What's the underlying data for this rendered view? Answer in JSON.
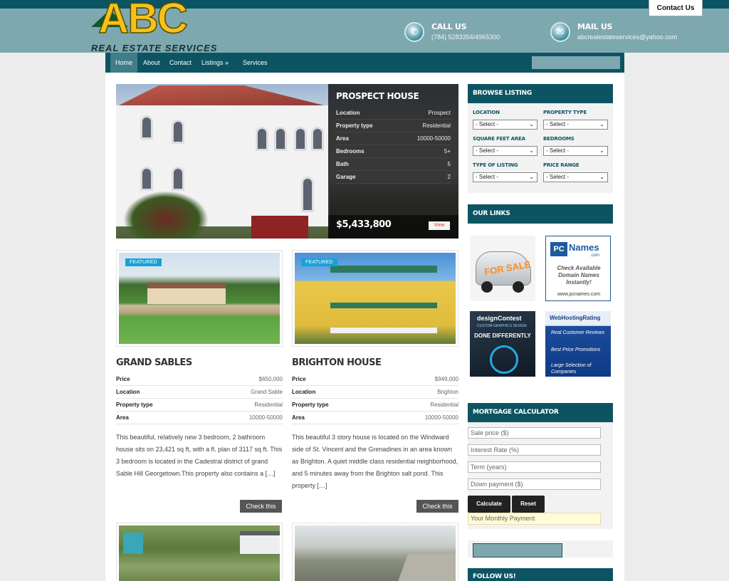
{
  "header": {
    "contact_tab": "Contact Us",
    "logo_letters": "ABC",
    "logo_tagline": "REAL ESTATE SERVICES",
    "call_label": "CALL US",
    "call_value": "(784) 5283354/4965300",
    "mail_label": "MAIL US",
    "mail_value": "abcrealestateservices@yahoo.com"
  },
  "nav": {
    "items": [
      "Home",
      "About",
      "Contact",
      "Listings »",
      "Services"
    ],
    "active": "Home"
  },
  "hero": {
    "title": "PROSPECT HOUSE",
    "rows": [
      {
        "k": "Location",
        "v": "Prospect"
      },
      {
        "k": "Property type",
        "v": "Residential"
      },
      {
        "k": "Area",
        "v": "10000-50000"
      },
      {
        "k": "Bedrooms",
        "v": "5+"
      },
      {
        "k": "Bath",
        "v": "5"
      },
      {
        "k": "Garage",
        "v": "2"
      }
    ],
    "price": "$5,433,800",
    "view_label": "View"
  },
  "listings": [
    {
      "badge": "FEATURED",
      "title": "GRAND SABLES",
      "rows": [
        {
          "k": "Price",
          "v": "$650,000"
        },
        {
          "k": "Location",
          "v": "Grand Sable"
        },
        {
          "k": "Property type",
          "v": "Residential"
        },
        {
          "k": "Area",
          "v": "10000-50000"
        }
      ],
      "desc": "This beautiful, relatively new 3 bedroom, 2 bathroom house sits on 23,421 sq ft, with a fl. plan of 3117 sq ft. This 3 bedroom is located in the Cadestral district of grand Sable Hill Georgetown.This property also contains a […]",
      "button": "Check this"
    },
    {
      "badge": "FEATURED",
      "title": "BRIGHTON HOUSE",
      "rows": [
        {
          "k": "Price",
          "v": "$949,000"
        },
        {
          "k": "Location",
          "v": "Brighton"
        },
        {
          "k": "Property type",
          "v": "Residential"
        },
        {
          "k": "Area",
          "v": "10000-50000"
        }
      ],
      "desc": "This beautiful 3 story house is located on the Windward side of St. Vincent and the Grenadines in an area known as Brighton. A quiet middle class residential neighborhood, and 5 minutes away from the Brighton salt pond. This property […]",
      "button": "Check this"
    }
  ],
  "browse": {
    "title": "BROWSE LISTING",
    "fields": [
      {
        "label": "LOCATION",
        "value": "- Select -"
      },
      {
        "label": "PROPERTY TYPE",
        "value": "- Select -"
      },
      {
        "label": "SQUARE FEET AREA",
        "value": "- Select -"
      },
      {
        "label": "BEDROOMS",
        "value": "- Select -"
      },
      {
        "label": "TYPE OF LISTING",
        "value": "- Select -"
      },
      {
        "label": "PRICE RANGE",
        "value": "- Select -"
      }
    ]
  },
  "links": {
    "title": "OUR LINKS",
    "car_text": "FOR SALE",
    "pcnames": {
      "brand": "Names",
      "sub": ".com",
      "text": "Check Available Domain Names Instantly!",
      "url": "www.pcnames.com"
    },
    "designcontest": {
      "brand": "designContest",
      "sub": "CUSTOM GRAPHICS DESIGN",
      "text": "DONE DIFFERENTLY"
    },
    "whr": {
      "brand": "WebHostingRating",
      "items": [
        "Real Customer Reviews",
        "Best Price Promotions",
        "Large Selection of Companies"
      ]
    }
  },
  "mortgage": {
    "title": "MORTGAGE CALCULATOR",
    "placeholders": [
      "Sale price ($)",
      "Interest Rate (%)",
      "Term (years)",
      "Down payment ($)"
    ],
    "calculate": "Calculate",
    "reset": "Reset",
    "result_placeholder": "Your Monthly Payment"
  },
  "follow": {
    "title": "FOLLOW US!"
  },
  "colors": {
    "brand_dark": "#0d5463",
    "header_bg": "#7ea8b0",
    "logo_yellow": "#f5c21b",
    "featured_blue": "#16a2d8"
  }
}
